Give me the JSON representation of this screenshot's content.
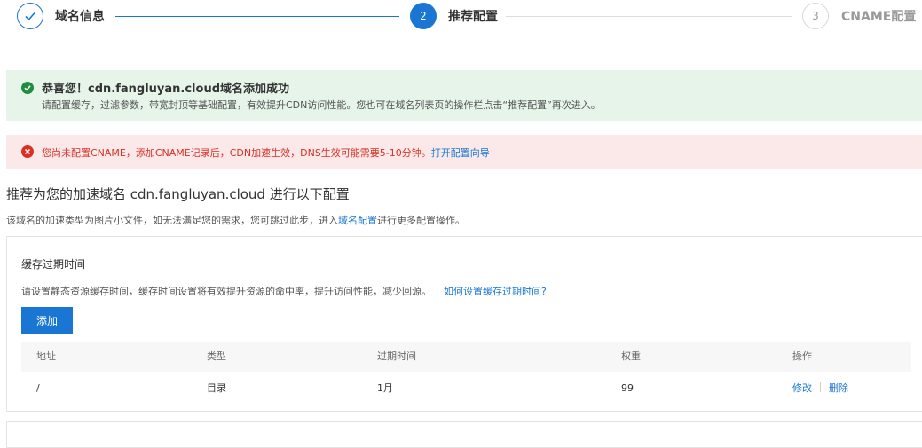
{
  "steps": [
    {
      "label": "域名信息",
      "state": "done"
    },
    {
      "label": "推荐配置",
      "number": "2",
      "state": "active"
    },
    {
      "label": "CNAME配置",
      "number": "3",
      "state": "todo"
    }
  ],
  "colors": {
    "primary": "#1976d2",
    "success": "#1e8e3e",
    "error": "#d93026"
  },
  "success_alert": {
    "icon": "check-circle-icon",
    "title": "恭喜您！cdn.fangluyan.cloud域名添加成功",
    "description": "请配置缓存，过滤参数，带宽封顶等基础配置，有效提升CDN访问性能。您也可在域名列表页的操作栏点击“推荐配置”再次进入。"
  },
  "error_alert": {
    "icon": "close-circle-icon",
    "message": "您尚未配置CNAME，添加CNAME记录后，CDN加速生效，DNS生效可能需要5-10分钟。",
    "link": "打开配置向导"
  },
  "section": {
    "title": "推荐为您的加速域名 cdn.fangluyan.cloud 进行以下配置",
    "desc_before": "该域名的加速类型为图片小文件，如无法满足您的需求，您可跳过此步，进入",
    "desc_link": "域名配置",
    "desc_after": "进行更多配置操作。"
  },
  "cache_card": {
    "title": "缓存过期时间",
    "description": "请设置静态资源缓存时间，缓存时间设置将有效提升资源的命中率，提升访问性能，减少回源。",
    "help_link": "如何设置缓存过期时间?",
    "add_button": "添加",
    "columns": [
      "地址",
      "类型",
      "过期时间",
      "权重",
      "操作"
    ],
    "rows": [
      {
        "address": "/",
        "type": "目录",
        "expire": "1月",
        "weight": "99",
        "edit": "修改",
        "delete": "删除"
      }
    ]
  }
}
